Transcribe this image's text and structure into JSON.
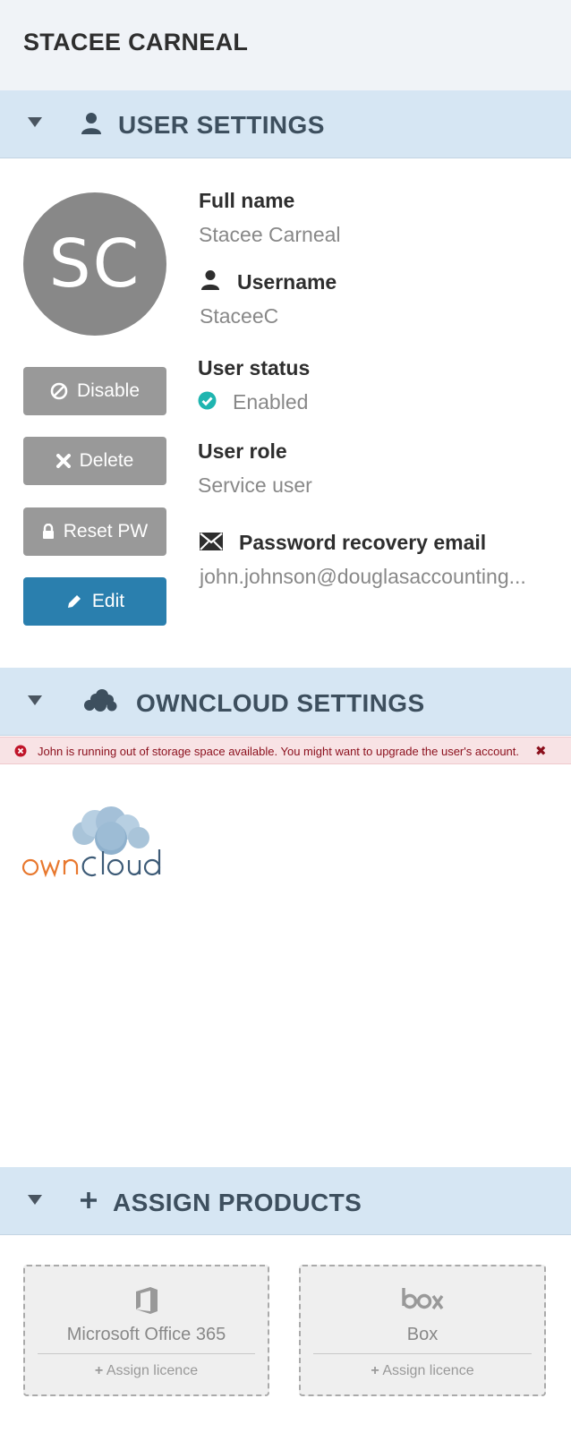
{
  "page": {
    "title": "STACEE CARNEAL"
  },
  "user_settings": {
    "section_label": "USER SETTINGS",
    "avatar_initials": "SC",
    "buttons": {
      "disable": "Disable",
      "delete": "Delete",
      "reset_pw": "Reset PW",
      "edit": "Edit"
    },
    "full_name": {
      "label": "Full name",
      "value": "Stacee Carneal"
    },
    "username": {
      "label": "Username",
      "value": "StaceeC"
    },
    "user_status": {
      "label": "User status",
      "value": "Enabled"
    },
    "user_role": {
      "label": "User role",
      "value": "Service user"
    },
    "recovery_email": {
      "label": "Password recovery email",
      "value": "john.johnson@douglasaccounting..."
    }
  },
  "owncloud_settings": {
    "section_label": "OWNCLOUD SETTINGS",
    "alert_text": "John is running out of storage space available. You might want to upgrade the user's account."
  },
  "assign_products": {
    "section_label": "ASSIGN PRODUCTS",
    "products": [
      {
        "name": "Microsoft Office 365",
        "assign_label": "Assign licence"
      },
      {
        "name": "Box",
        "assign_label": "Assign licence"
      }
    ]
  },
  "colors": {
    "section_bar": "#d6e6f3",
    "primary_button": "#2a7fae",
    "secondary_button": "#999999",
    "status_ok": "#1fb5b0",
    "alert_text": "#8b0f1c",
    "owncloud_orange": "#e8782e",
    "owncloud_blue": "#3d5b77"
  }
}
